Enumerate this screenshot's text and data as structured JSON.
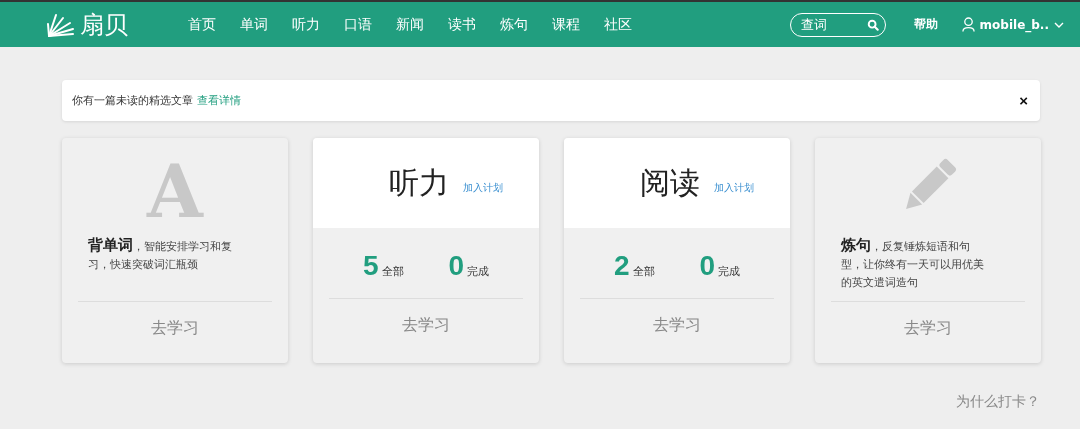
{
  "header": {
    "logo": "扇贝",
    "nav": [
      {
        "label": "首页",
        "selected": false
      },
      {
        "label": "单词",
        "selected": false
      },
      {
        "label": "听力",
        "selected": false
      },
      {
        "label": "口语",
        "selected": false
      },
      {
        "label": "新闻",
        "selected": false
      },
      {
        "label": "读书",
        "selected": false
      },
      {
        "label": "炼句",
        "selected": false
      },
      {
        "label": "课程",
        "selected": false
      },
      {
        "label": "社区",
        "selected": false
      }
    ],
    "search": {
      "placeholder": "查词"
    },
    "help": "帮助",
    "user": "mobile_b.."
  },
  "notice": {
    "text": "你有一篇未读的精选文章",
    "link": "查看详情",
    "close": "×"
  },
  "cards": [
    {
      "kind": "intro",
      "glyph": "A",
      "description": "**背单词**，智能安排学习和复习，快速突破词汇瓶颈",
      "action": "去学习"
    },
    {
      "kind": "plan",
      "title": "听力",
      "plan_link": "加入计划",
      "total": "5",
      "total_label": "全部",
      "done": "0",
      "done_label": "完成",
      "action": "去学习"
    },
    {
      "kind": "plan",
      "title": "阅读",
      "plan_link": "加入计划",
      "total": "2",
      "total_label": "全部",
      "done": "0",
      "done_label": "完成",
      "action": "去学习"
    },
    {
      "kind": "intro",
      "description": "**炼句**，反复锤炼短语和句型，让你终有一天可以用优美的英文遣词造句",
      "action": "去学习"
    }
  ],
  "footer_link": "为什么打卡？"
}
